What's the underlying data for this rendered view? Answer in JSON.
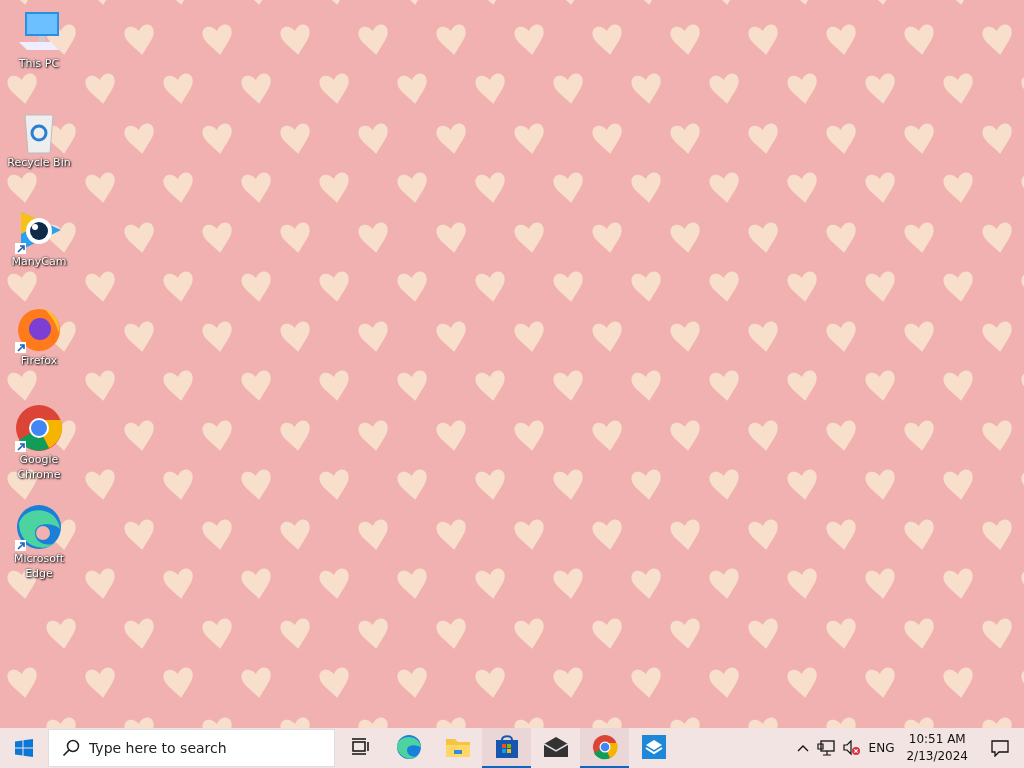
{
  "desktop_icons": [
    {
      "kind": "computer",
      "label": "This PC",
      "shortcut": false
    },
    {
      "kind": "recycle",
      "label": "Recycle Bin",
      "shortcut": false
    },
    {
      "kind": "camera",
      "label": "ManyCam",
      "shortcut": true
    },
    {
      "kind": "firefox",
      "label": "Firefox",
      "shortcut": true
    },
    {
      "kind": "chrome",
      "label": "Google Chrome",
      "shortcut": true
    },
    {
      "kind": "edge",
      "label": "Microsoft Edge",
      "shortcut": true
    }
  ],
  "taskbar": {
    "search": {
      "placeholder": "Type here to search"
    },
    "apps": [
      {
        "kind": "taskview",
        "running": false
      },
      {
        "kind": "edge",
        "running": false
      },
      {
        "kind": "folder",
        "running": false
      },
      {
        "kind": "store",
        "running": true
      },
      {
        "kind": "mail",
        "running": false
      },
      {
        "kind": "chrome",
        "running": true
      },
      {
        "kind": "box",
        "running": false
      }
    ],
    "tray": {
      "language": "ENG",
      "time": "10:51 AM",
      "date": "2/13/2024"
    }
  }
}
